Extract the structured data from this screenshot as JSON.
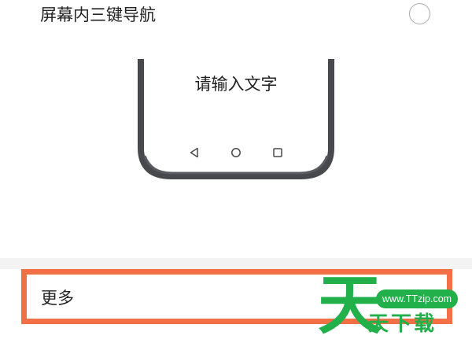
{
  "settings": {
    "option_label": "屏幕内三键导航",
    "option_selected": false,
    "preview_text": "请输入文字",
    "nav_keys": [
      "back-icon",
      "home-icon",
      "recents-icon"
    ],
    "more_label": "更多"
  },
  "colors": {
    "highlight": "#f36f45",
    "phone_frame": "#48494d",
    "watermark": "#22b04a",
    "divider": "#f3f3f3"
  },
  "watermark": {
    "url": "www.TTzip.com",
    "big": "天",
    "small": "天下载"
  }
}
